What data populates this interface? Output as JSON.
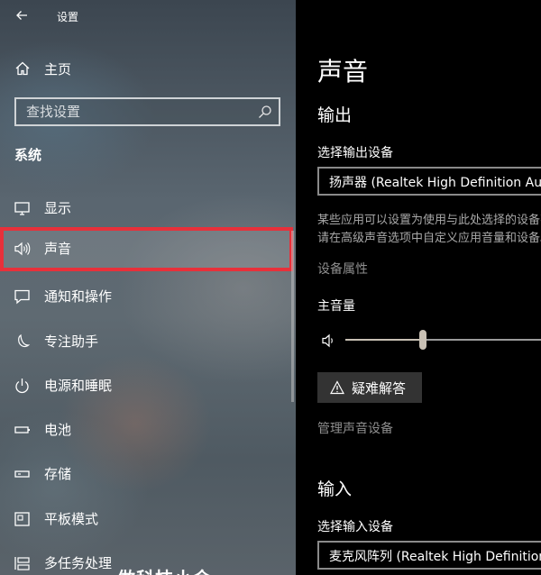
{
  "window": {
    "title": "设置"
  },
  "sidebar": {
    "home_label": "主页",
    "search_placeholder": "查找设置",
    "section_title": "系统",
    "items": [
      {
        "label": "显示",
        "icon": "monitor-icon"
      },
      {
        "label": "声音",
        "icon": "speaker-icon",
        "selected": true
      },
      {
        "label": "通知和操作",
        "icon": "chat-bubble-icon"
      },
      {
        "label": "专注助手",
        "icon": "moon-icon"
      },
      {
        "label": "电源和睡眠",
        "icon": "power-icon"
      },
      {
        "label": "电池",
        "icon": "battery-icon"
      },
      {
        "label": "存储",
        "icon": "storage-drive-icon"
      },
      {
        "label": "平板模式",
        "icon": "tablet-mode-icon"
      },
      {
        "label": "多任务处理",
        "icon": "multitasking-icon"
      }
    ],
    "overlay_text": "做科技小金"
  },
  "main": {
    "title": "声音",
    "output": {
      "heading": "输出",
      "device_label": "选择输出设备",
      "device_value": "扬声器 (Realtek High Definition Audio)",
      "description_line1": "某些应用可以设置为使用与此处选择的设备不同的",
      "description_line2": "请在高级声音选项中自定义应用音量和设备。",
      "device_properties_link": "设备属性",
      "volume_label": "主音量",
      "volume_fraction": 0.39,
      "troubleshoot_label": "疑难解答",
      "manage_devices_link": "管理声音设备"
    },
    "input": {
      "heading": "输入",
      "device_label": "选择输入设备",
      "device_value": "麦克风阵列 (Realtek High Definition Audio)"
    }
  },
  "colors": {
    "selection_border": "#e8303a",
    "accent_slider": "#c8c0b4"
  }
}
